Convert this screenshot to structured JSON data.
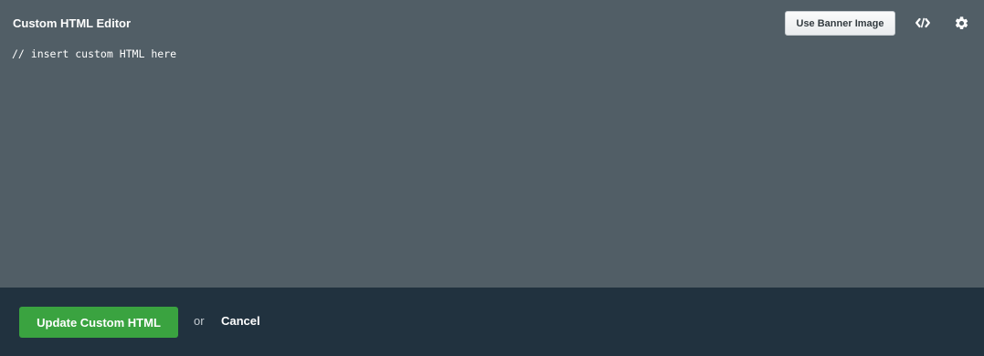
{
  "editor": {
    "title": "Custom HTML Editor",
    "banner_button_label": "Use Banner Image",
    "code_toggle_icon": "code-icon",
    "settings_icon": "gear-icon",
    "code_content": "// insert custom HTML here"
  },
  "footer": {
    "update_button_label": "Update Custom HTML",
    "or_text": "or",
    "cancel_label": "Cancel"
  },
  "colors": {
    "editor_background": "#515e66",
    "footer_background": "#21323f",
    "primary_button": "#3aa340"
  }
}
